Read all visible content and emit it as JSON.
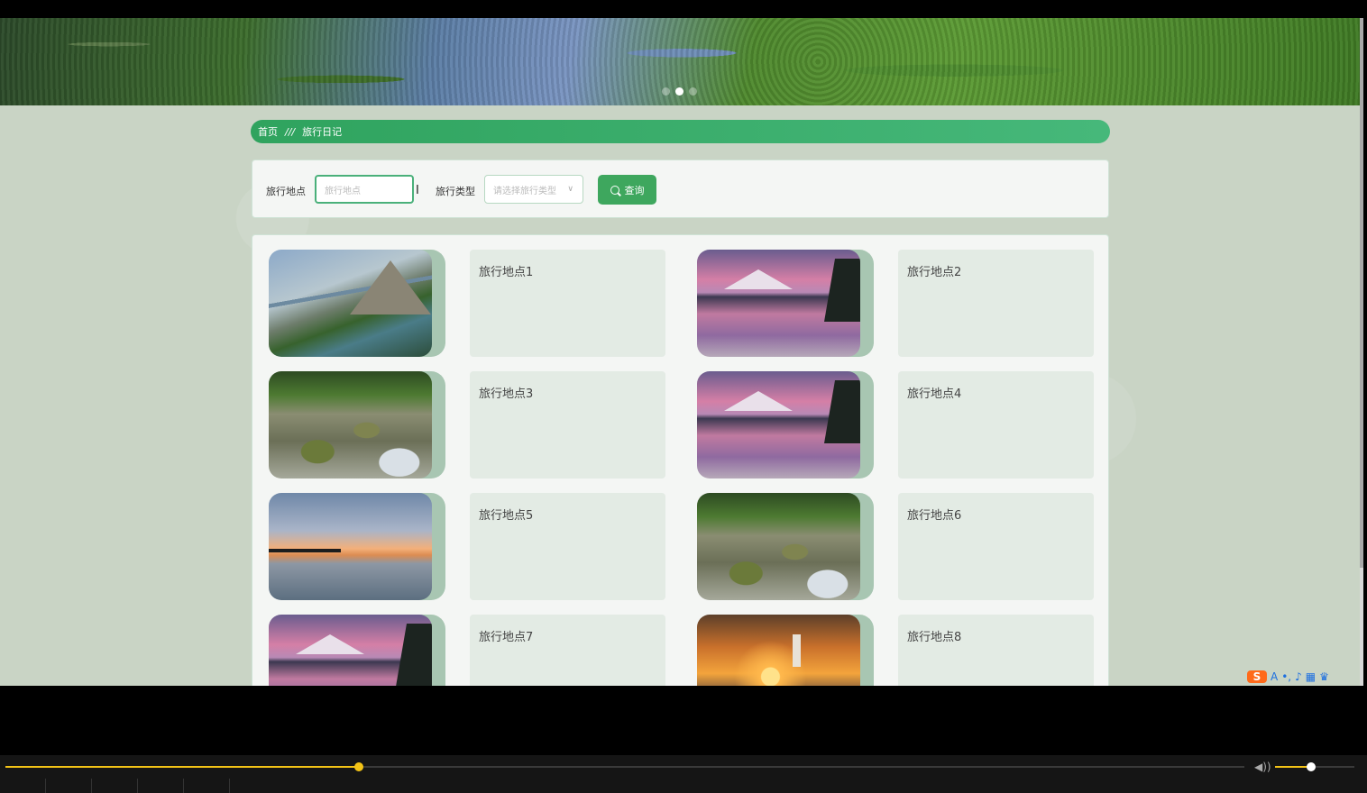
{
  "breadcrumb": {
    "home": "首页",
    "separator": "///",
    "current": "旅行日记"
  },
  "search": {
    "location_label": "旅行地点",
    "location_placeholder": "旅行地点",
    "type_label": "旅行类型",
    "type_placeholder": "请选择旅行类型",
    "button_label": "查询"
  },
  "carousel": {
    "slides": 3,
    "active_index": 1
  },
  "items": [
    {
      "title": "旅行地点1",
      "image": "mountain-lake"
    },
    {
      "title": "旅行地点2",
      "image": "sunset-lake"
    },
    {
      "title": "旅行地点3",
      "image": "river"
    },
    {
      "title": "旅行地点4",
      "image": "sunset-lake"
    },
    {
      "title": "旅行地点5",
      "image": "pier"
    },
    {
      "title": "旅行地点6",
      "image": "river"
    },
    {
      "title": "旅行地点7",
      "image": "sunset-lake"
    },
    {
      "title": "旅行地点8",
      "image": "lighthouse"
    }
  ],
  "player": {
    "progress": 0.285,
    "volume": 0.45
  },
  "colors": {
    "accent": "#3ea75e",
    "breadcrumb": "#2fa35e",
    "progress": "#f3c316"
  }
}
